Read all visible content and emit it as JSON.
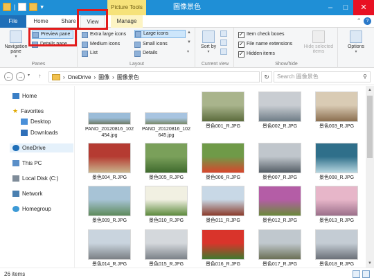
{
  "window": {
    "title": "圖像景色",
    "picture_tools": "Picture Tools",
    "minimize": "–",
    "maximize": "□",
    "close": "✕"
  },
  "tabs": {
    "file": "File",
    "home": "Home",
    "share": "Share",
    "view": "View",
    "manage": "Manage"
  },
  "ribbon": {
    "panes": {
      "navigation_pane": "Navigation pane",
      "preview_pane": "Preview pane",
      "details_pane": "Details pane",
      "label": "Panes"
    },
    "layout": {
      "extra_large_icons": "Extra large icons",
      "large_icons": "Large icons",
      "medium_icons": "Medium icons",
      "small_icons": "Small icons",
      "list": "List",
      "details": "Details",
      "label": "Layout"
    },
    "current_view": {
      "sort_by": "Sort by",
      "label": "Current view"
    },
    "show_hide": {
      "item_check_boxes": "Item check boxes",
      "file_name_extensions": "File name extensions",
      "hidden_items": "Hidden items",
      "hide_selected_items": "Hide selected items",
      "label": "Show/hide"
    },
    "options": "Options"
  },
  "address": {
    "back": "←",
    "forward": "→",
    "up": "↑",
    "crumbs": [
      "OneDrive",
      "圖像",
      "圖像景色"
    ],
    "separator": "›",
    "search_placeholder": "Search 圖像景色"
  },
  "nav": {
    "home": "Home",
    "favorites": "Favorites",
    "desktop": "Desktop",
    "downloads": "Downloads",
    "onedrive": "OneDrive",
    "this_pc": "This PC",
    "local_disk": "Local Disk (C:)",
    "network": "Network",
    "homegroup": "Homegroup"
  },
  "files": [
    {
      "name": "PANO_20120816_102454.jpg",
      "c1": "#9bbcd8",
      "c2": "#6f7b66"
    },
    {
      "name": "PANO_20120816_102645.jpg",
      "c1": "#a8c4e0",
      "c2": "#7a8a6a"
    },
    {
      "name": "景色001_R.JPG",
      "c1": "#a9b48c",
      "c2": "#5b6b3c"
    },
    {
      "name": "景色002_R.JPG",
      "c1": "#c9cdd2",
      "c2": "#6e7c86"
    },
    {
      "name": "景色003_R.JPG",
      "c1": "#d9cbb4",
      "c2": "#8a6e4f"
    },
    {
      "name": "景色004_R.JPG",
      "c1": "#b53b32",
      "c2": "#c9b58e"
    },
    {
      "name": "景色005_R.JPG",
      "c1": "#7aa05a",
      "c2": "#3f6a2e"
    },
    {
      "name": "景色006_R.JPG",
      "c1": "#6f9a48",
      "c2": "#d8452c"
    },
    {
      "name": "景色007_R.JPG",
      "c1": "#c0c6cc",
      "c2": "#555e66"
    },
    {
      "name": "景色008_R.JPG",
      "c1": "#2f6f8a",
      "c2": "#b7d6e0"
    },
    {
      "name": "景色009_R.JPG",
      "c1": "#a7c3d6",
      "c2": "#5d8a5b"
    },
    {
      "name": "景色010_R.JPG",
      "c1": "#f1f0e2",
      "c2": "#5c8a3c"
    },
    {
      "name": "景色011_R.JPG",
      "c1": "#c8d8e6",
      "c2": "#8a3a2a"
    },
    {
      "name": "景色012_R.JPG",
      "c1": "#b45da6",
      "c2": "#6a8a3a"
    },
    {
      "name": "景色013_R.JPG",
      "c1": "#e7b6c9",
      "c2": "#9b6f8a"
    },
    {
      "name": "景色014_R.JPG",
      "c1": "#c9d4de",
      "c2": "#7a7f84"
    },
    {
      "name": "景色015_R.JPG",
      "c1": "#d4d8dc",
      "c2": "#7b8188"
    },
    {
      "name": "景色016_R.JPG",
      "c1": "#d9342b",
      "c2": "#3e7a2e"
    },
    {
      "name": "景色017_R.JPG",
      "c1": "#c0c8ce",
      "c2": "#6a6f55"
    },
    {
      "name": "景色018_R.JPG",
      "c1": "#c4ccd4",
      "c2": "#6b7078"
    }
  ],
  "status": {
    "count": "26 items"
  }
}
